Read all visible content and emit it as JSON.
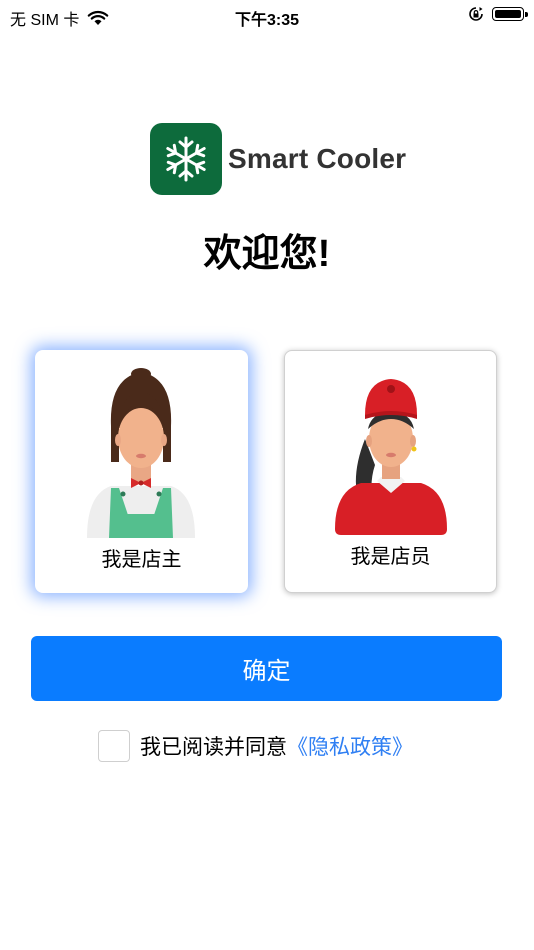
{
  "status_bar": {
    "carrier": "无 SIM 卡",
    "time": "下午3:35",
    "battery_level": 1.0
  },
  "brand": {
    "name": "Smart Cooler",
    "logo_icon": "snowflake-icon",
    "logo_color": "#0d6b3c"
  },
  "welcome": "欢迎您!",
  "roles": [
    {
      "label": "我是店主",
      "selected": true
    },
    {
      "label": "我是店员",
      "selected": false
    }
  ],
  "confirm_button": {
    "label": "确定",
    "color": "#0a7cff"
  },
  "agreement": {
    "text": "我已阅读并同意",
    "policy_link": "《隐私政策》",
    "checked": false,
    "link_color": "#2f7ff3"
  }
}
